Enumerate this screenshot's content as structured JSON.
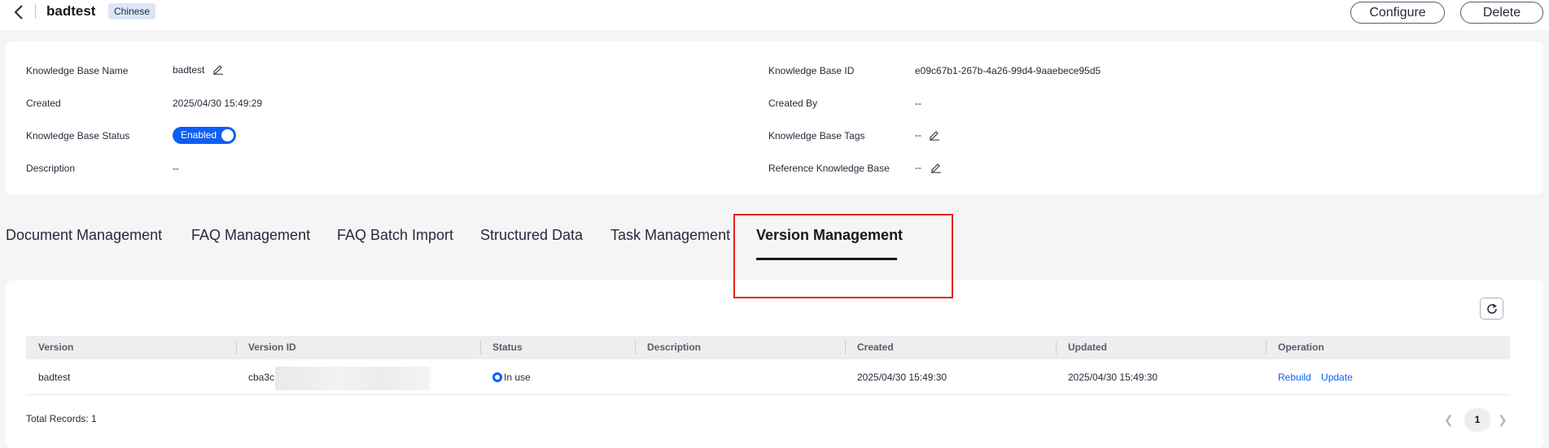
{
  "header": {
    "title": "badtest",
    "language_badge": "Chinese",
    "configure_label": "Configure",
    "delete_label": "Delete"
  },
  "info": {
    "kb_name_label": "Knowledge Base Name",
    "kb_name_value": "badtest",
    "created_label": "Created",
    "created_value": "2025/04/30 15:49:29",
    "status_label": "Knowledge Base Status",
    "status_toggle": "Enabled",
    "description_label": "Description",
    "description_value": "--",
    "kb_id_label": "Knowledge Base ID",
    "kb_id_value": "e09c67b1-267b-4a26-99d4-9aaebece95d5",
    "created_by_label": "Created By",
    "created_by_value": "--",
    "tags_label": "Knowledge Base Tags",
    "tags_value": "--",
    "reference_label": "Reference Knowledge Base",
    "reference_value": "--"
  },
  "tabs": [
    {
      "label": "Document Management",
      "active": false
    },
    {
      "label": "FAQ Management",
      "active": false
    },
    {
      "label": "FAQ Batch Import",
      "active": false
    },
    {
      "label": "Structured Data",
      "active": false
    },
    {
      "label": "Task Management",
      "active": false
    },
    {
      "label": "Version Management",
      "active": true
    }
  ],
  "table": {
    "columns": [
      "Version",
      "Version ID",
      "Status",
      "Description",
      "Created",
      "Updated",
      "Operation"
    ],
    "rows": [
      {
        "version": "badtest",
        "version_id": "cba3c",
        "status": "In use",
        "description": "",
        "created": "2025/04/30 15:49:30",
        "updated": "2025/04/30 15:49:30",
        "op_rebuild": "Rebuild",
        "op_update": "Update"
      }
    ],
    "total_records": "Total Records: 1"
  },
  "pagination": {
    "current_page": "1"
  },
  "colors": {
    "accent": "#0d5ff2",
    "highlight": "#e5211c"
  }
}
